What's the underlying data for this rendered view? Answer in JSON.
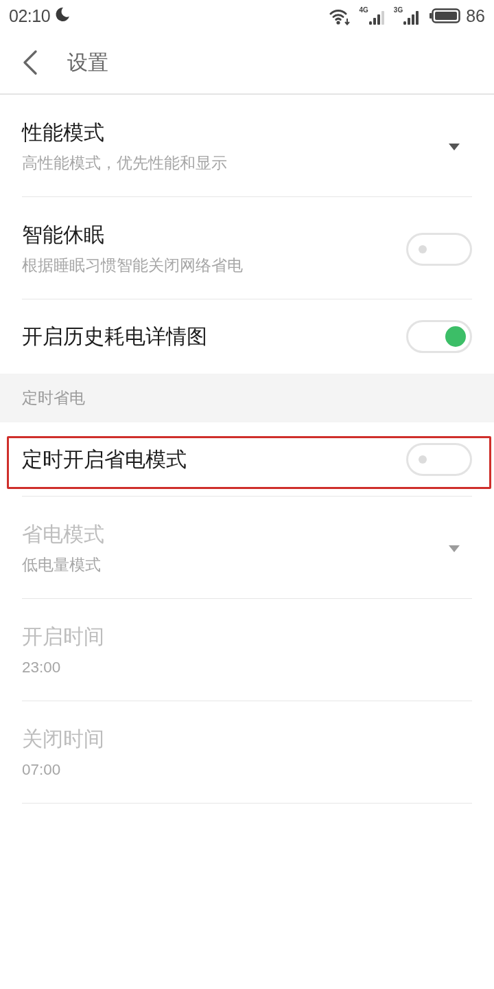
{
  "status_bar": {
    "time": "02:10",
    "network_labels": [
      "4G",
      "3G"
    ],
    "battery": "86"
  },
  "header": {
    "title": "设置"
  },
  "sections": [
    {
      "items": [
        {
          "kind": "dropdown",
          "title": "性能模式",
          "subtitle": "高性能模式，优先性能和显示",
          "disabled": false,
          "highlighted": false
        },
        {
          "kind": "toggle",
          "title": "智能休眠",
          "subtitle": "根据睡眠习惯智能关闭网络省电",
          "on": false,
          "disabled": false,
          "highlighted": false
        },
        {
          "kind": "toggle",
          "title": "开启历史耗电详情图",
          "on": true,
          "disabled": false,
          "highlighted": false
        }
      ]
    },
    {
      "header": "定时省电",
      "items": [
        {
          "kind": "toggle",
          "title": "定时开启省电模式",
          "on": false,
          "disabled": false,
          "highlighted": true
        },
        {
          "kind": "dropdown",
          "title": "省电模式",
          "subtitle": "低电量模式",
          "disabled": true,
          "highlighted": false
        },
        {
          "kind": "detail",
          "title": "开启时间",
          "subtitle": "23:00",
          "disabled": true,
          "highlighted": false
        },
        {
          "kind": "detail",
          "title": "关闭时间",
          "subtitle": "07:00",
          "disabled": true,
          "highlighted": false
        }
      ]
    }
  ]
}
